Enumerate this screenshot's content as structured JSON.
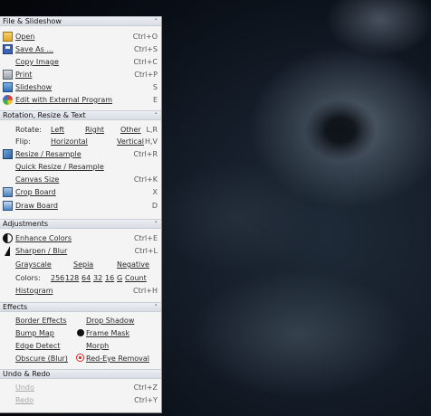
{
  "sections": {
    "file": {
      "title": "File & Slideshow",
      "items": [
        {
          "label": "Open",
          "shortcut": "Ctrl+O",
          "icon": "folder-open-icon"
        },
        {
          "label": "Save As ...",
          "shortcut": "Ctrl+S",
          "icon": "floppy-disk-icon"
        },
        {
          "label": "Copy Image",
          "shortcut": "Ctrl+C"
        },
        {
          "label": "Print",
          "shortcut": "Ctrl+P",
          "icon": "printer-icon"
        },
        {
          "label": "Slideshow",
          "shortcut": "S",
          "icon": "slideshow-icon"
        },
        {
          "label": "Edit with External Program",
          "shortcut": "E",
          "icon": "paint-palette-icon"
        }
      ]
    },
    "rotation": {
      "title": "Rotation, Resize & Text",
      "rotate_label": "Rotate:",
      "rotate_left": "Left",
      "rotate_right": "Right",
      "rotate_other": "Other",
      "rotate_shortcut": "L,R",
      "flip_label": "Flip:",
      "flip_horizontal": "Horizontal",
      "flip_vertical": "Vertical",
      "flip_shortcut": "H,V",
      "resize": "Resize / Resample",
      "resize_shortcut": "Ctrl+R",
      "quick_resize": "Quick Resize / Resample",
      "canvas_size": "Canvas Size",
      "canvas_shortcut": "Ctrl+K",
      "crop_board": "Crop Board",
      "crop_shortcut": "X",
      "draw_board": "Draw Board",
      "draw_shortcut": "D"
    },
    "adjustments": {
      "title": "Adjustments",
      "enhance": "Enhance Colors",
      "enhance_shortcut": "Ctrl+E",
      "sharpen": "Sharpen / Blur",
      "sharpen_shortcut": "Ctrl+L",
      "grayscale": "Grayscale",
      "sepia": "Sepia",
      "negative": "Negative",
      "colors_label": "Colors:",
      "colors": [
        "256",
        "128",
        "64",
        "32",
        "16",
        "G",
        "Count"
      ],
      "histogram": "Histogram",
      "histogram_shortcut": "Ctrl+H"
    },
    "effects": {
      "title": "Effects",
      "border_effects": "Border Effects",
      "drop_shadow": "Drop Shadow",
      "bump_map": "Bump Map",
      "frame_mask": "Frame Mask",
      "edge_detect": "Edge Detect",
      "morph": "Morph",
      "obscure": "Obscure (Blur)",
      "red_eye": "Red-Eye Removal"
    },
    "undo": {
      "title": "Undo & Redo",
      "undo": "Undo",
      "undo_shortcut": "Ctrl+Z",
      "redo": "Redo",
      "redo_shortcut": "Ctrl+Y"
    }
  },
  "collapse_glyph": "˄"
}
